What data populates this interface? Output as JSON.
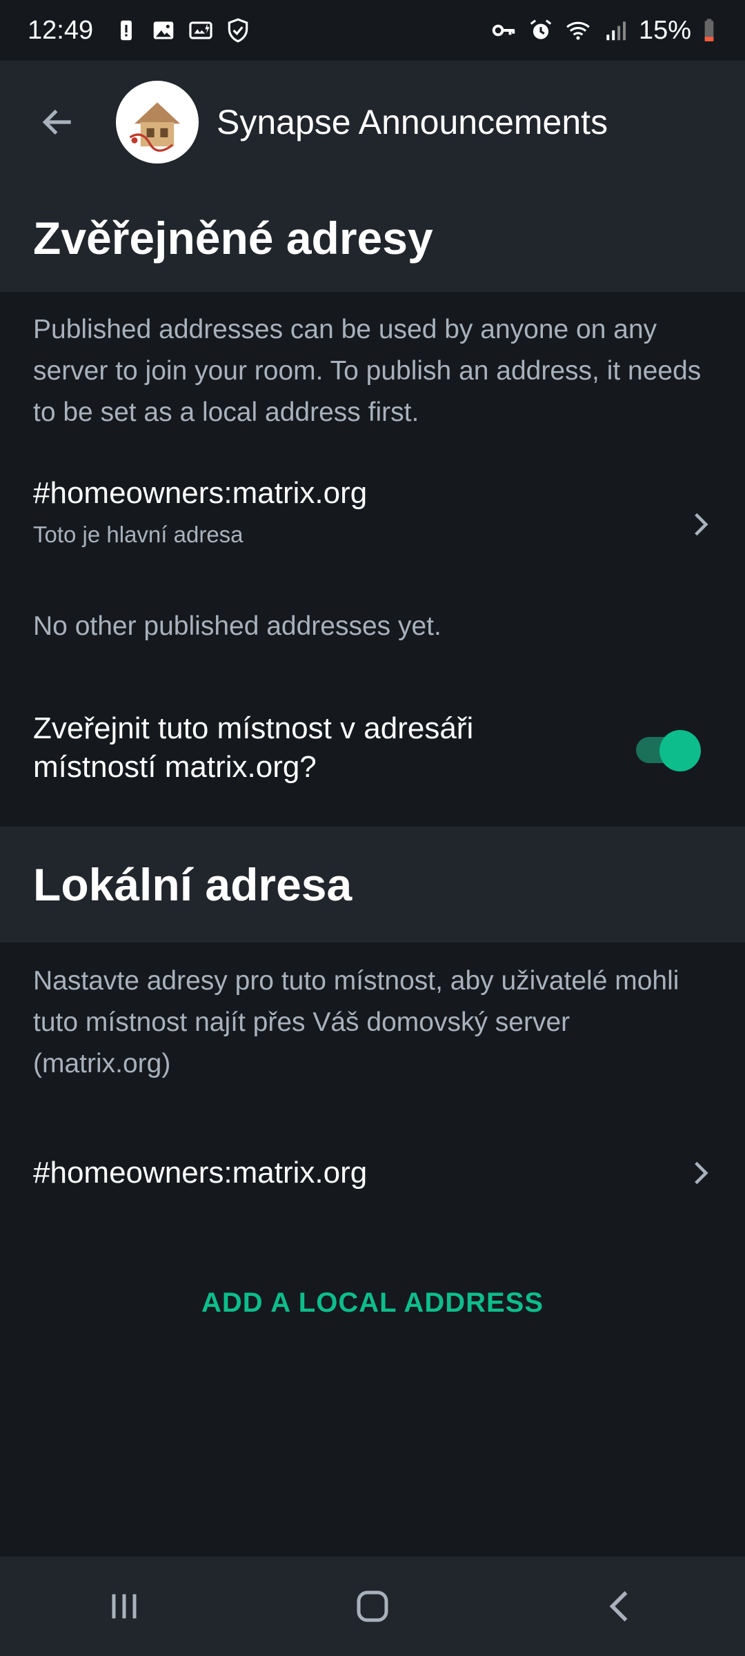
{
  "status_bar": {
    "time": "12:49",
    "battery_percent": "15%",
    "left_icons": [
      "battery-alert-icon",
      "image-icon",
      "screenshot-icon",
      "shield-icon"
    ],
    "right_icons": [
      "vpn-key-icon",
      "alarm-icon",
      "wifi-icon",
      "signal-icon",
      "battery-icon"
    ]
  },
  "app_bar": {
    "title": "Synapse Announcements",
    "avatar": "room-avatar"
  },
  "published_section": {
    "header": "Zvěřejněné adresy",
    "description": "Published addresses can be used by anyone on any server to join your room. To publish an address, it needs to be set as a local address first.",
    "main_address": "#homeowners:matrix.org",
    "main_address_sub": "Toto je hlavní adresa",
    "empty_text": "No other published addresses yet.",
    "directory_toggle_label": "Zveřejnit tuto místnost v adresáři místností matrix.org?",
    "directory_toggle_on": true
  },
  "local_section": {
    "header": "Lokální adresa",
    "description": "Nastavte adresy pro tuto místnost, aby uživatelé mohli tuto místnost najít přes Váš domovský server (matrix.org)",
    "address": "#homeowners:matrix.org",
    "add_button": "ADD A LOCAL ADDRESS"
  },
  "colors": {
    "background": "#15191e",
    "surface": "#21262c",
    "accent": "#0dbd8b",
    "secondary_text": "#a9b2bc"
  },
  "nav_bar": {
    "buttons": [
      "recent-apps-icon",
      "home-icon",
      "back-icon"
    ]
  }
}
